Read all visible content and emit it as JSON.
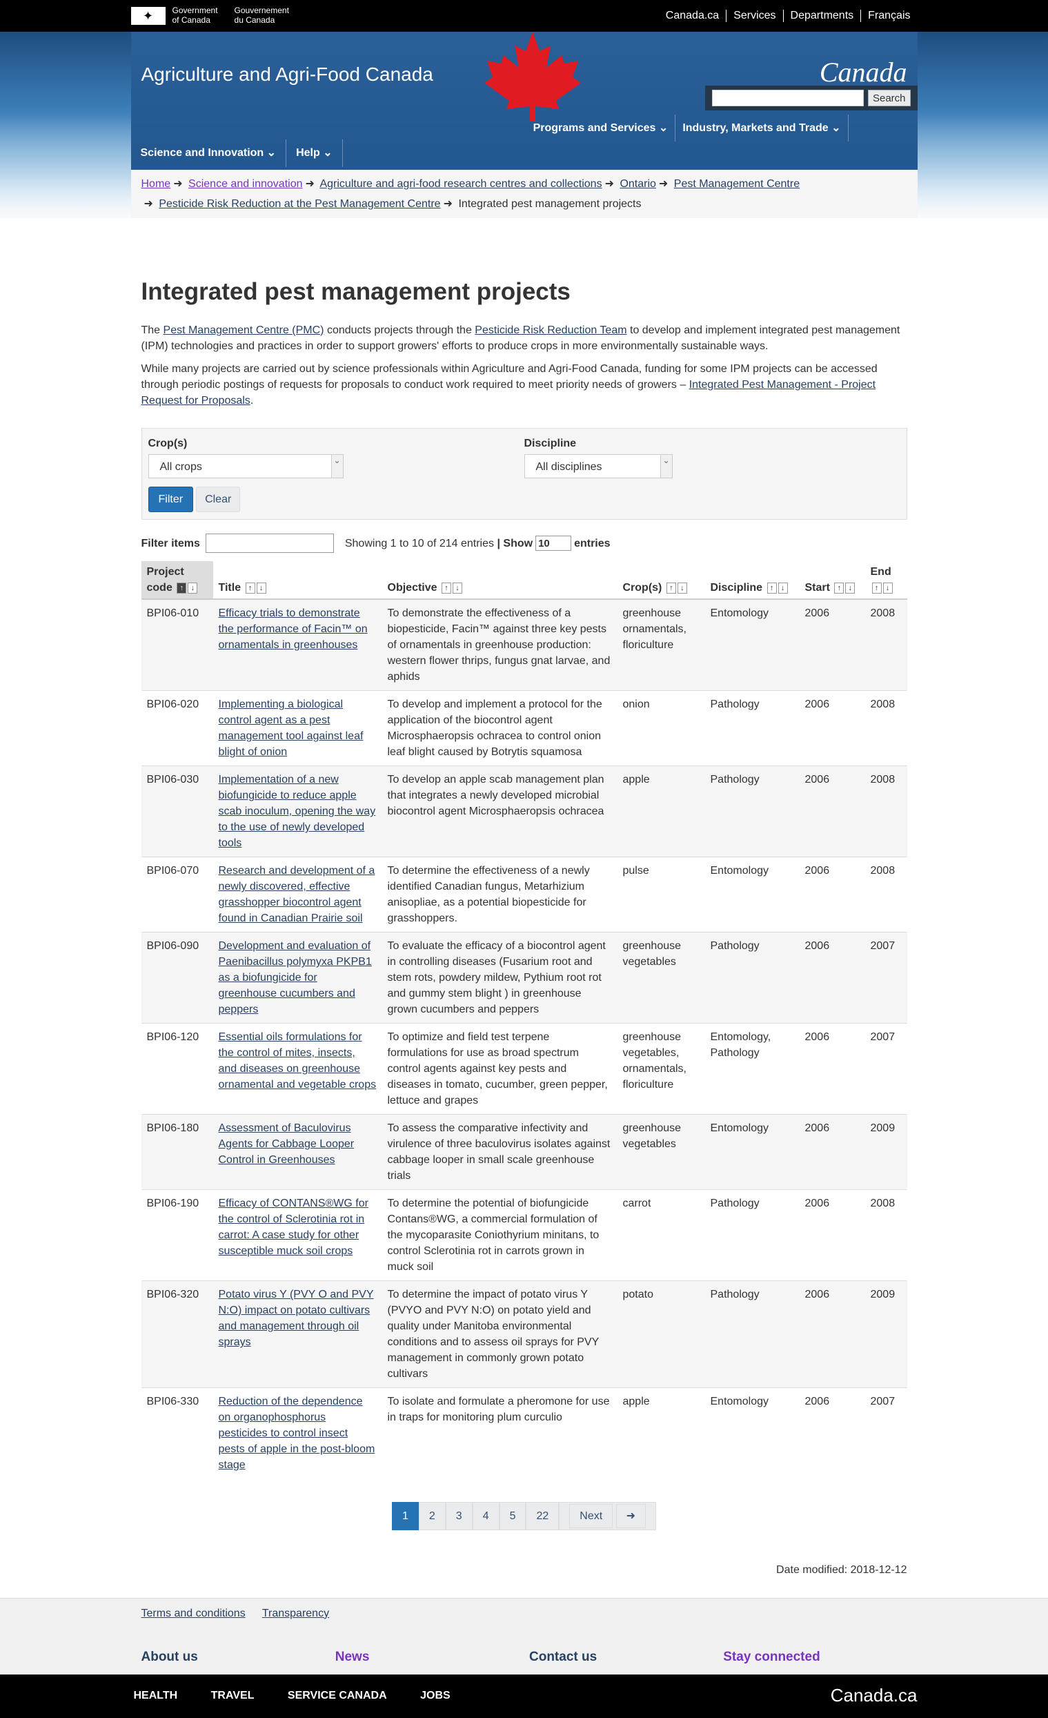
{
  "gov": {
    "en": "Government\nof Canada",
    "fr": "Gouvernement\ndu Canada",
    "en1": "Government",
    "en2": "of Canada",
    "fr1": "Gouvernement",
    "fr2": "du Canada"
  },
  "govnav": [
    "Canada.ca",
    "Services",
    "Departments",
    "Français"
  ],
  "site_title": "Agriculture and Agri-Food Canada",
  "wordmark": "Canada",
  "search": {
    "placeholder": "",
    "button": "Search"
  },
  "menu_primary": [
    "Programs and Services",
    "Industry, Markets and Trade"
  ],
  "menu_secondary": [
    "Science and Innovation",
    "Help"
  ],
  "breadcrumb": [
    "Home",
    "Science and innovation",
    "Agriculture and agri-food research centres and collections",
    "Ontario",
    "Pest Management Centre",
    "Pesticide Risk Reduction at the Pest Management Centre",
    "Integrated pest management projects"
  ],
  "page_title": "Integrated pest management projects",
  "intro1": {
    "a": "The ",
    "l1": "Pest Management Centre (PMC)",
    "b": " conducts projects through the ",
    "l2": "Pesticide Risk Reduction Team",
    "c": " to develop and implement integrated pest management (IPM) technologies and practices in order to support growers' efforts to produce crops in more environmentally sustainable ways."
  },
  "intro2": {
    "a": "While many projects are carried out by science professionals within Agriculture and Agri-Food Canada, funding for some IPM projects can be accessed through periodic postings of requests for proposals to conduct work required to meet priority needs of growers – ",
    "l": "Integrated Pest Management - Project Request for Proposals",
    "b": "."
  },
  "filters": {
    "crop_label": "Crop(s)",
    "crop_value": "All crops",
    "disc_label": "Discipline",
    "disc_value": "All disciplines",
    "filter_btn": "Filter",
    "clear_btn": "Clear"
  },
  "table_ctrl": {
    "filter_label": "Filter items",
    "showing": "Showing 1 to 10 of 214 entries",
    "sep": "|",
    "show": "Show",
    "show_value": "10",
    "entries": "entries"
  },
  "columns": [
    "Project code",
    "Title",
    "Objective",
    "Crop(s)",
    "Discipline",
    "Start",
    "End"
  ],
  "rows": [
    {
      "code": "BPI06-010",
      "title": "Efficacy trials to demonstrate the performance of Facin™ on ornamentals in greenhouses",
      "objective": "To demonstrate the effectiveness of a biopesticide, Facin™ against three key pests of ornamentals in greenhouse production: western flower thrips, fungus gnat larvae, and aphids",
      "crops": "greenhouse ornamentals, floriculture",
      "discipline": "Entomology",
      "start": "2006",
      "end": "2008"
    },
    {
      "code": "BPI06-020",
      "title": "Implementing a biological control agent as a pest management tool against leaf blight of onion",
      "objective": "To develop and implement a protocol for the application of the biocontrol agent Microsphaeropsis ochracea to control onion leaf blight caused by Botrytis squamosa",
      "crops": "onion",
      "discipline": "Pathology",
      "start": "2006",
      "end": "2008"
    },
    {
      "code": "BPI06-030",
      "title": "Implementation of a new biofungicide to reduce apple scab inoculum, opening the way to the use of newly developed tools",
      "objective": "To develop an apple scab management plan that integrates a newly developed microbial biocontrol agent Microsphaeropsis ochracea",
      "crops": "apple",
      "discipline": "Pathology",
      "start": "2006",
      "end": "2008"
    },
    {
      "code": "BPI06-070",
      "title": "Research and development of a newly discovered, effective grasshopper biocontrol agent found in Canadian Prairie soil",
      "objective": "To determine the effectiveness of a newly identified Canadian fungus, Metarhizium anisopliae, as a potential biopesticide for grasshoppers.",
      "crops": "pulse",
      "discipline": "Entomology",
      "start": "2006",
      "end": "2008"
    },
    {
      "code": "BPI06-090",
      "title": "Development and evaluation of Paenibacillus polymyxa PKPB1 as a biofungicide for greenhouse cucumbers and peppers",
      "objective": "To evaluate the efficacy of a biocontrol agent in controlling diseases (Fusarium root and stem rots, powdery mildew, Pythium root rot and gummy stem blight ) in greenhouse grown cucumbers and peppers",
      "crops": "greenhouse vegetables",
      "discipline": "Pathology",
      "start": "2006",
      "end": "2007"
    },
    {
      "code": "BPI06-120",
      "title": "Essential oils formulations for the control of mites, insects, and diseases on greenhouse ornamental and vegetable crops",
      "objective": "To optimize and field test terpene formulations for use as broad spectrum control agents against key pests and diseases in tomato, cucumber, green pepper, lettuce and grapes",
      "crops": "greenhouse vegetables, ornamentals, floriculture",
      "discipline": "Entomology, Pathology",
      "start": "2006",
      "end": "2007"
    },
    {
      "code": "BPI06-180",
      "title": "Assessment of Baculovirus Agents for Cabbage Looper Control in Greenhouses",
      "objective": "To assess the comparative infectivity and virulence of three baculovirus isolates against cabbage looper in small scale greenhouse trials",
      "crops": "greenhouse vegetables",
      "discipline": "Entomology",
      "start": "2006",
      "end": "2009"
    },
    {
      "code": "BPI06-190",
      "title": "Efficacy of CONTANS®WG for the control of Sclerotinia rot in carrot: A case study for other susceptible muck soil crops",
      "objective": "To determine the potential of biofungicide Contans®WG, a commercial formulation of the mycoparasite Coniothyrium minitans, to control Sclerotinia rot in carrots grown in muck soil",
      "crops": "carrot",
      "discipline": "Pathology",
      "start": "2006",
      "end": "2008"
    },
    {
      "code": "BPI06-320",
      "title": "Potato virus Y (PVY O and PVY N:O) impact on potato cultivars and management through oil sprays",
      "objective": "To determine the impact of potato virus Y (PVYO and PVY N:O) on potato yield and quality under Manitoba environmental conditions and to assess oil sprays for PVY management in commonly grown potato cultivars",
      "crops": "potato",
      "discipline": "Pathology",
      "start": "2006",
      "end": "2009"
    },
    {
      "code": "BPI06-330",
      "title": "Reduction of the dependence on organophosphorus pesticides to control insect pests of apple in the post-bloom stage",
      "objective": "To isolate and formulate a pheromone for use in traps for monitoring plum curculio",
      "crops": "apple",
      "discipline": "Entomology",
      "start": "2006",
      "end": "2007"
    }
  ],
  "pager": [
    "1",
    "2",
    "3",
    "4",
    "5",
    "22",
    "Next"
  ],
  "date_modified": "Date modified: 2018-12-12",
  "footer_links": [
    "Terms and conditions",
    "Transparency"
  ],
  "footer_cols": [
    "About us",
    "News",
    "Contact us",
    "Stay connected"
  ],
  "footer_bottom": [
    "HEALTH",
    "TRAVEL",
    "SERVICE CANADA",
    "JOBS"
  ],
  "footer_wordmark": "Canada.ca",
  "colors": {
    "gov_bar": "#000000",
    "banner": "#22578f",
    "link": "#284162",
    "visited": "#7834bc",
    "primary_btn": "#2572b4",
    "leaf": "#e01b22"
  }
}
